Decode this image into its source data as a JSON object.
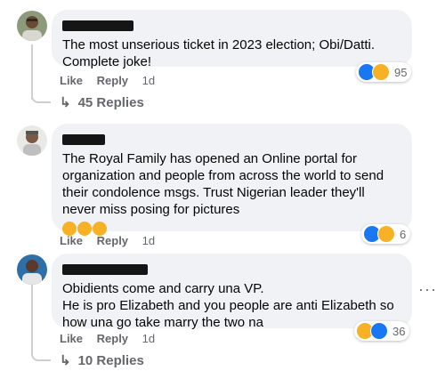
{
  "comments": [
    {
      "text": "The most unserious ticket in 2023 election; Obi/Datti. Complete joke!",
      "like_label": "Like",
      "reply_label": "Reply",
      "time": "1d",
      "reaction_count": "95",
      "reaction_icons": [
        "like-icon",
        "haha-icon"
      ],
      "replies_label": "45 Replies"
    },
    {
      "text": "The Royal Family has opened an Online portal for organization and people from across the world to send their condolence msgs. Trust Nigerian leader they'll never miss posing for pictures",
      "inline_emojis": [
        "laughing-tears-emoji",
        "laughing-tears-emoji",
        "laughing-tears-emoji"
      ],
      "like_label": "Like",
      "reply_label": "Reply",
      "time": "1d",
      "reaction_count": "6",
      "reaction_icons": [
        "like-icon",
        "haha-icon"
      ]
    },
    {
      "text": "Obidients come and carry una VP.\nHe is pro Elizabeth and you people are anti Elizabeth so how una go take marry the two na",
      "like_label": "Like",
      "reply_label": "Reply",
      "time": "1d",
      "reaction_count": "36",
      "reaction_icons": [
        "haha-icon",
        "like-icon"
      ],
      "replies_label": "10 Replies"
    }
  ],
  "more_options_icon": "more-horizontal-icon",
  "colors": {
    "bubble": "#f0f2f5",
    "secondary_text": "#65676b",
    "like_blue": "#1877f2",
    "haha_yellow": "#f7b125"
  }
}
